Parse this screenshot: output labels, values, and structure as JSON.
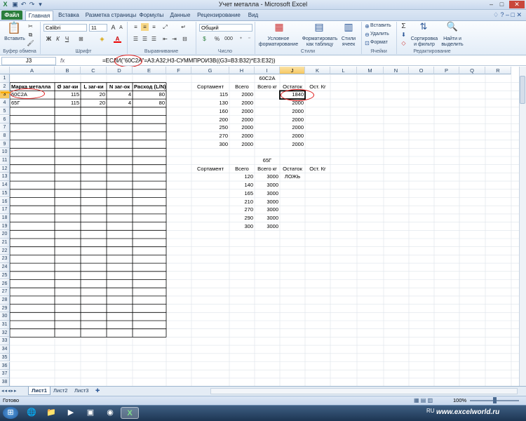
{
  "window": {
    "title": "Учет металла  -  Microsoft Excel",
    "minimize": "–",
    "maximize": "□",
    "close": "✕"
  },
  "tabs": [
    "Файл",
    "Главная",
    "Вставка",
    "Разметка страницы",
    "Формулы",
    "Данные",
    "Рецензирование",
    "Вид"
  ],
  "ribbon": {
    "clipboard": {
      "group": "Буфер обмена",
      "paste": "Вставить"
    },
    "font": {
      "group": "Шрифт",
      "name": "Calibri",
      "size": "11",
      "bold": "Ж",
      "italic": "К",
      "underline": "Ч",
      "grow": "A",
      "shrink": "A",
      "fontcolor": "A"
    },
    "alignment": {
      "group": "Выравнивание"
    },
    "number": {
      "group": "Число",
      "format": "Общий",
      "percent": "%",
      "thousands": "000"
    },
    "styles": {
      "group": "Стили",
      "conditional": "Условное форматирование",
      "table": "Форматировать как таблицу",
      "cellstyles": "Стили ячеек"
    },
    "cells": {
      "group": "Ячейки",
      "insert": "Вставить",
      "delete": "Удалить",
      "format": "Формат"
    },
    "editing": {
      "group": "Редактирование",
      "sigma": "Σ",
      "sort": "Сортировка и фильтр",
      "find": "Найти и выделить"
    }
  },
  "formula_bar": {
    "name_box": "J3",
    "fx": "fx",
    "formula": "=ЕСЛИ(\"60С2А\"=A3:A32;H3-СУММПРОИЗВ((G3=B3:B32)*E3:E32))"
  },
  "columns": [
    "A",
    "B",
    "C",
    "D",
    "E",
    "F",
    "G",
    "H",
    "I",
    "J",
    "K",
    "L",
    "M",
    "N",
    "O",
    "P",
    "Q",
    "R"
  ],
  "rows": [
    "1",
    "2",
    "3",
    "4",
    "5",
    "6",
    "7",
    "8",
    "9",
    "10",
    "11",
    "12",
    "13",
    "14",
    "15",
    "16",
    "17",
    "18",
    "19",
    "20",
    "21",
    "22",
    "23",
    "24",
    "25",
    "26",
    "27",
    "28",
    "29",
    "30",
    "31",
    "32",
    "33",
    "34",
    "35",
    "36",
    "37",
    "38"
  ],
  "cells": {
    "I1": "60С2А",
    "A2": "Марка металла",
    "B2": "Ø заг-ки",
    "C2": "L заг-ки",
    "D2": "N заг-ок",
    "E2": "Расход (L/N)",
    "G2": "Сортамент",
    "H2": "Всего",
    "I2": "Всего кг",
    "J2": "Остаток",
    "K2": "Ост. Кг",
    "A3": "60С2А",
    "B3": "115",
    "C3": "20",
    "D3": "4",
    "E3": "80",
    "G3": "115",
    "H3": "2000",
    "J3": "1840",
    "A4": "65Г",
    "B4": "115",
    "C4": "20",
    "D4": "4",
    "E4": "80",
    "G4": "130",
    "H4": "2000",
    "J4": "2000",
    "G5": "160",
    "H5": "2000",
    "J5": "2000",
    "G6": "200",
    "H6": "2000",
    "J6": "2000",
    "G7": "250",
    "H7": "2000",
    "J7": "2000",
    "G8": "270",
    "H8": "2000",
    "J8": "2000",
    "G9": "300",
    "H9": "2000",
    "J9": "2000",
    "I11": "65Г",
    "G12": "Сортамент",
    "H12": "Всего",
    "I12": "Всего кг",
    "J12": "Остаток",
    "K12": "Ост. Кг",
    "H13": "120",
    "I13": "3000",
    "J13": "ЛОЖЬ",
    "H14": "140",
    "I14": "3000",
    "H15": "165",
    "I15": "3000",
    "H16": "210",
    "I16": "3000",
    "H17": "270",
    "I17": "3000",
    "H18": "290",
    "I18": "3000",
    "H19": "300",
    "I19": "3000"
  },
  "sheets": [
    "Лист1",
    "Лист2",
    "Лист3"
  ],
  "status": {
    "ready": "Готово",
    "zoom": "100%"
  },
  "taskbar": {
    "lang": "RU",
    "watermark": "www.excelworld.ru"
  },
  "colors": {
    "file_tab": "#2a7e3b",
    "annotation": "#e02020",
    "selected": "#f6c75f"
  }
}
